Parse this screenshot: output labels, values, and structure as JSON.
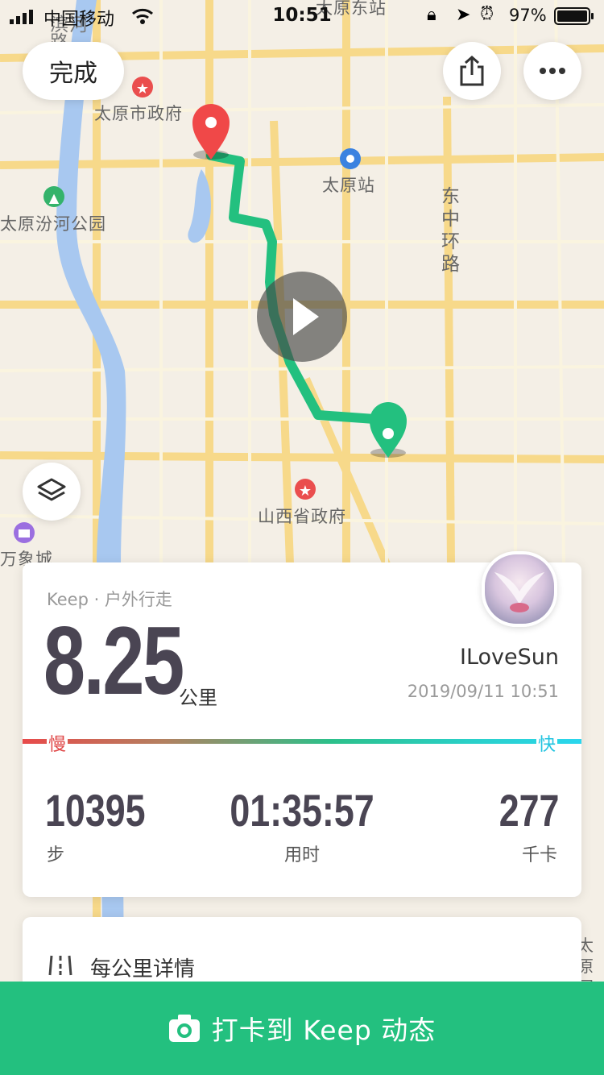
{
  "status_bar": {
    "carrier": "中国移动",
    "time": "10:51",
    "battery": "97%"
  },
  "toolbar": {
    "done_label": "完成",
    "share_icon": "share-icon",
    "more_icon": "more-icon"
  },
  "map": {
    "labels": {
      "city_hall": "太原市政府",
      "station": "太原站",
      "east_station": "太原东站",
      "park": "太原汾河公园",
      "ring_road": "东中环路",
      "province": "山西省政府",
      "mall": "万象城",
      "river_road": "滨河路",
      "taiyuan_intl": "太原国际"
    },
    "colors": {
      "route_start": "#23c07f",
      "start_pin": "#23c07f",
      "end_pin": "#f04848",
      "river": "#a8c8f0",
      "road": "#f7d98a"
    }
  },
  "card": {
    "subtitle": "Keep · 户外行走",
    "distance": "8.25",
    "distance_unit": "公里",
    "username": "ILoveSun",
    "datetime": "2019/09/11 10:51",
    "pace_slow": "慢",
    "pace_fast": "快",
    "stats": {
      "steps_value": "10395",
      "steps_label": "步",
      "duration_value": "01:35:57",
      "duration_label": "用时",
      "calories_value": "277",
      "calories_label": "千卡"
    }
  },
  "detail_card": {
    "label": "每公里详情"
  },
  "bottom_button": {
    "label": "打卡到 Keep 动态"
  }
}
